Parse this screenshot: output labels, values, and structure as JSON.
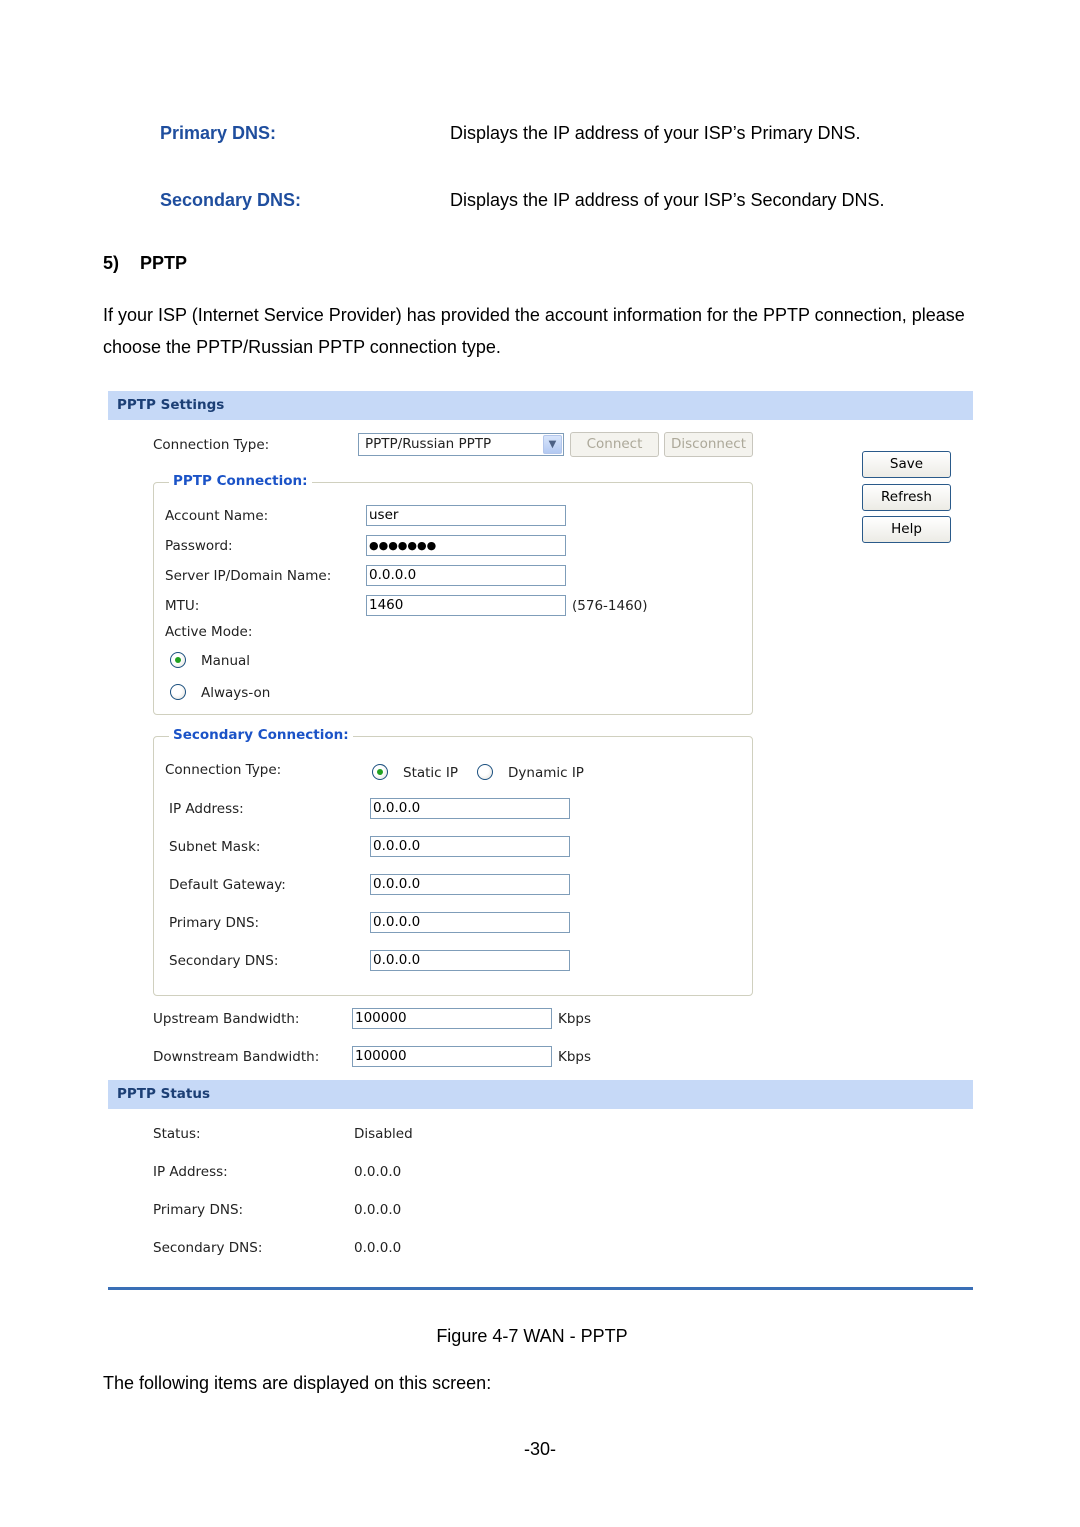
{
  "definitions": [
    {
      "term": "Primary DNS:",
      "description": "Displays the IP address of your ISP’s Primary DNS."
    },
    {
      "term": "Secondary DNS:",
      "description": "Displays the IP address of your ISP’s Secondary DNS."
    }
  ],
  "section": {
    "number": "5)",
    "title": "PPTP",
    "intro": "If your ISP (Internet Service Provider) has provided the account information for the PPTP connection, please choose the PPTP/Russian PPTP connection type."
  },
  "figure": {
    "settings_header": "PPTP Settings",
    "connection_type_label": "Connection Type:",
    "connection_type_value": "PPTP/Russian PPTP",
    "connect_label": "Connect",
    "disconnect_label": "Disconnect",
    "side_buttons": {
      "save": "Save",
      "refresh": "Refresh",
      "help": "Help"
    },
    "pptp_connection": {
      "legend": "PPTP Connection:",
      "account_name_label": "Account Name:",
      "account_name_value": "user",
      "password_label": "Password:",
      "password_value": "●●●●●●●",
      "server_label": "Server IP/Domain Name:",
      "server_value": "0.0.0.0",
      "mtu_label": "MTU:",
      "mtu_value": "1460",
      "mtu_range": "(576-1460)",
      "active_mode_label": "Active Mode:",
      "modes": [
        {
          "label": "Manual",
          "selected": true
        },
        {
          "label": "Always-on",
          "selected": false
        }
      ]
    },
    "secondary_connection": {
      "legend": "Secondary Connection:",
      "connection_type_label": "Connection Type:",
      "types": [
        {
          "label": "Static IP",
          "selected": true
        },
        {
          "label": "Dynamic IP",
          "selected": false
        }
      ],
      "fields": [
        {
          "label": "IP Address:",
          "value": "0.0.0.0"
        },
        {
          "label": "Subnet Mask:",
          "value": "0.0.0.0"
        },
        {
          "label": "Default Gateway:",
          "value": "0.0.0.0"
        },
        {
          "label": "Primary DNS:",
          "value": "0.0.0.0"
        },
        {
          "label": "Secondary DNS:",
          "value": "0.0.0.0"
        }
      ]
    },
    "bandwidth": [
      {
        "label": "Upstream Bandwidth:",
        "value": "100000",
        "unit": "Kbps"
      },
      {
        "label": "Downstream Bandwidth:",
        "value": "100000",
        "unit": "Kbps"
      }
    ],
    "status_header": "PPTP Status",
    "status": [
      {
        "label": "Status:",
        "value": "Disabled"
      },
      {
        "label": "IP Address:",
        "value": "0.0.0.0"
      },
      {
        "label": "Primary DNS:",
        "value": "0.0.0.0"
      },
      {
        "label": "Secondary DNS:",
        "value": "0.0.0.0"
      }
    ],
    "caption": "Figure 4-7 WAN - PPTP"
  },
  "following_text": "The following items are displayed on this screen:",
  "page_number": "-30-"
}
